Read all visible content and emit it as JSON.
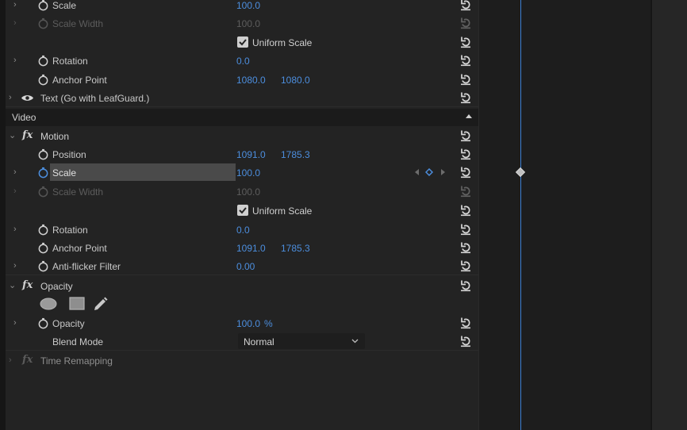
{
  "effect_controls": {
    "upper": {
      "scale": {
        "label": "Scale",
        "value": "100.0"
      },
      "scale_width": {
        "label": "Scale Width",
        "value": "100.0"
      },
      "uniform_scale": {
        "label": "Uniform Scale",
        "checked": true
      },
      "rotation": {
        "label": "Rotation",
        "value": "0.0"
      },
      "anchor_point": {
        "label": "Anchor Point",
        "x": "1080.0",
        "y": "1080.0"
      }
    },
    "text_layer": {
      "label": "Text (Go with LeafGuard.)"
    },
    "video_section": {
      "title": "Video"
    },
    "motion": {
      "label": "Motion",
      "position": {
        "label": "Position",
        "x": "1091.0",
        "y": "1785.3"
      },
      "scale": {
        "label": "Scale",
        "value": "100.0"
      },
      "scale_width": {
        "label": "Scale Width",
        "value": "100.0"
      },
      "uniform_scale": {
        "label": "Uniform Scale",
        "checked": true
      },
      "rotation": {
        "label": "Rotation",
        "value": "0.0"
      },
      "anchor_point": {
        "label": "Anchor Point",
        "x": "1091.0",
        "y": "1785.3"
      },
      "anti_flicker": {
        "label": "Anti-flicker Filter",
        "value": "0.00"
      }
    },
    "opacity": {
      "label": "Opacity",
      "opacity_value": {
        "label": "Opacity",
        "value": "100.0",
        "unit": "%"
      },
      "blend_mode": {
        "label": "Blend Mode",
        "value": "Normal"
      }
    },
    "time_remapping": {
      "label": "Time Remapping"
    }
  },
  "colors": {
    "accent_blue": "#4c8ede",
    "playhead": "#3c7fd4",
    "panel_bg": "#232323"
  }
}
